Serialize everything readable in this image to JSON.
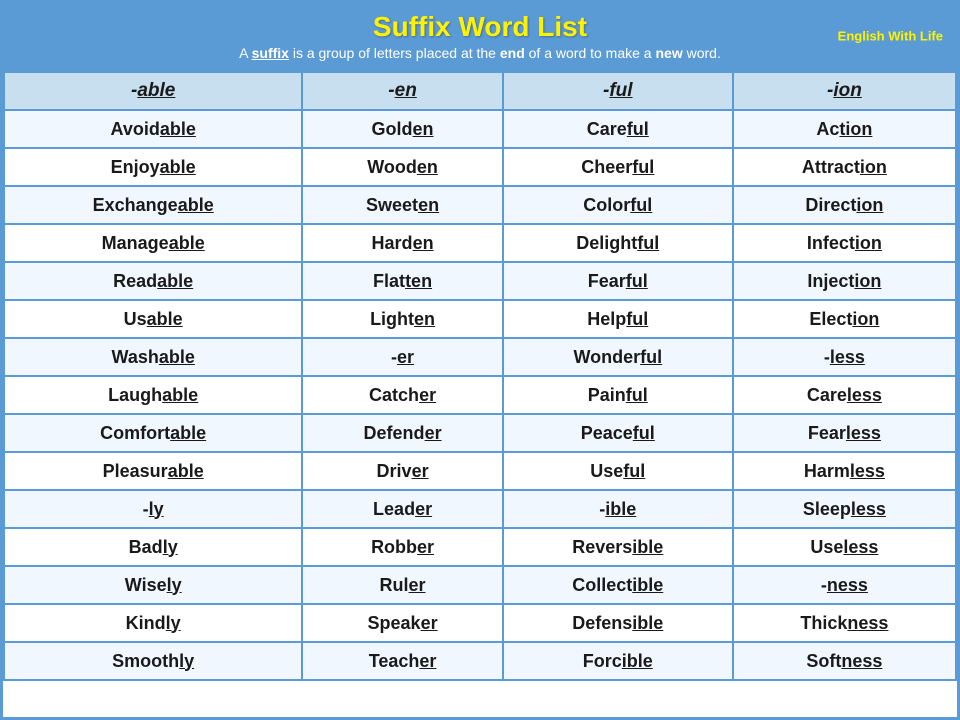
{
  "header": {
    "title": "Suffix Word List",
    "subtitle_pre": "A ",
    "suffix_word": "suffix",
    "subtitle_mid": " is a group of letters placed at the ",
    "end_word": "end",
    "subtitle_mid2": " of a word to make a ",
    "new_word": "new",
    "subtitle_post": " word.",
    "brand_line1": "English With Life"
  },
  "columns": [
    "-able",
    "-en",
    "-ful",
    "-ion"
  ],
  "rows": [
    [
      "Avoidable",
      "Golden",
      "Careful",
      "Action"
    ],
    [
      "Enjoyable",
      "Wooden",
      "Cheerful",
      "Attraction"
    ],
    [
      "Exchangeable",
      "Sweeten",
      "Colorful",
      "Direction"
    ],
    [
      "Manageable",
      "Harden",
      "Delightful",
      "Infection"
    ],
    [
      "Readable",
      "Flatten",
      "Fearful",
      "Injection"
    ],
    [
      "Usable",
      "Lighten",
      "Helpful",
      "Election"
    ],
    [
      "Washable",
      "-er",
      "Wonderful",
      "-less"
    ],
    [
      "Laughable",
      "Catcher",
      "Painful",
      "Careless"
    ],
    [
      "Comfortable",
      "Defender",
      "Peaceful",
      "Fearless"
    ],
    [
      "Pleasurable",
      "Driver",
      "Useful",
      "Harmless"
    ],
    [
      "-ly",
      "Leader",
      "-ible",
      "Sleepless"
    ],
    [
      "Badly",
      "Robber",
      "Reversible",
      "Useless"
    ],
    [
      "Wisely",
      "Ruler",
      "Collectible",
      "-ness"
    ],
    [
      "Kindly",
      "Speaker",
      "Defensible",
      "Thickness"
    ],
    [
      "Smoothly",
      "Teacher",
      "Forcible",
      "Softness"
    ]
  ],
  "suffixes": {
    "able": "able",
    "en": "en",
    "ful": "ful",
    "ion": "ion",
    "er": "er",
    "less": "less",
    "ly": "ly",
    "ible": "ible",
    "ness": "ness"
  }
}
